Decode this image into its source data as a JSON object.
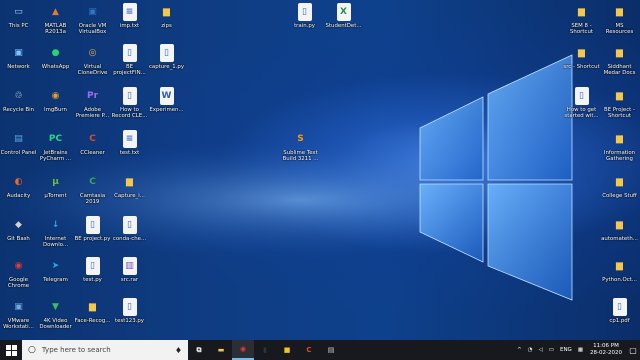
{
  "desktop": {
    "icons": [
      {
        "label": "This PC",
        "icon": "this-pc-icon",
        "color": "#9fd1ff"
      },
      {
        "label": "MATLAB R2013a",
        "icon": "matlab-icon",
        "color": "#e8792b"
      },
      {
        "label": "Oracle VM VirtualBox",
        "icon": "virtualbox-icon",
        "color": "#2f76c4"
      },
      {
        "label": "imp.txt",
        "icon": "text-file-icon",
        "color": "#ffffff"
      },
      {
        "label": "zips",
        "icon": "folder-icon",
        "color": "#f5c74b"
      },
      {
        "label": "train.py",
        "icon": "python-file-icon",
        "color": "#ffffff"
      },
      {
        "label": "StudentDet...",
        "icon": "excel-file-icon",
        "color": "#2a8a4a"
      },
      {
        "label": "SEM 8 - Shortcut",
        "icon": "folder-shortcut-icon",
        "color": "#f5c74b"
      },
      {
        "label": "MS Resources",
        "icon": "folder-icon",
        "color": "#f5c74b"
      },
      {
        "label": "Network",
        "icon": "network-icon",
        "color": "#7fc4ff"
      },
      {
        "label": "WhatsApp",
        "icon": "whatsapp-icon",
        "color": "#2cd46b"
      },
      {
        "label": "Virtual CloneDrive",
        "icon": "clonedrive-icon",
        "color": "#e0b050"
      },
      {
        "label": "BE projectFIN...",
        "icon": "file-icon",
        "color": "#ffffff"
      },
      {
        "label": "capture_1.py",
        "icon": "python-file-icon",
        "color": "#ffffff"
      },
      {
        "label": "src - Shortcut",
        "icon": "folder-shortcut-icon",
        "color": "#f5c74b"
      },
      {
        "label": "Siddhant Medar Docs",
        "icon": "folder-icon",
        "color": "#f5c74b"
      },
      {
        "label": "Recycle Bin",
        "icon": "recycle-bin-icon",
        "color": "#cfe3ff"
      },
      {
        "label": "ImgBurn",
        "icon": "imgburn-icon",
        "color": "#f0a020"
      },
      {
        "label": "Adobe Premiere P...",
        "icon": "premiere-icon",
        "color": "#9b6df2"
      },
      {
        "label": "How to Record CLE...",
        "icon": "file-icon",
        "color": "#ffffff"
      },
      {
        "label": "Experimen...",
        "icon": "word-file-icon",
        "color": "#2b5fb8"
      },
      {
        "label": "How to get started wit...",
        "icon": "file-icon",
        "color": "#ffffff"
      },
      {
        "label": "BE Project - Shortcut",
        "icon": "folder-shortcut-icon",
        "color": "#f5c74b"
      },
      {
        "label": "Control Panel",
        "icon": "control-panel-icon",
        "color": "#5aa8e6"
      },
      {
        "label": "JetBrains PyCharm ...",
        "icon": "pycharm-icon",
        "color": "#21d789"
      },
      {
        "label": "CCleaner",
        "icon": "ccleaner-icon",
        "color": "#e04b2a"
      },
      {
        "label": "test.txt",
        "icon": "text-file-icon",
        "color": "#ffffff"
      },
      {
        "label": "Sublime Text Build 3211 ...",
        "icon": "sublime-text-icon",
        "color": "#ff9800"
      },
      {
        "label": "Information Gathering",
        "icon": "folder-icon",
        "color": "#f5c74b"
      },
      {
        "label": "Audacity",
        "icon": "audacity-icon",
        "color": "#f06a1a"
      },
      {
        "label": "µTorrent",
        "icon": "utorrent-icon",
        "color": "#6cbf3a"
      },
      {
        "label": "Camtasia 2019",
        "icon": "camtasia-icon",
        "color": "#3fa34d"
      },
      {
        "label": "Capture_i...",
        "icon": "folder-icon",
        "color": "#f5c74b"
      },
      {
        "label": "College Stuff",
        "icon": "folder-icon",
        "color": "#f5c74b"
      },
      {
        "label": "Git Bash",
        "icon": "git-bash-icon",
        "color": "#d0d0d0"
      },
      {
        "label": "Internet Downlo...",
        "icon": "idm-icon",
        "color": "#3c9be0"
      },
      {
        "label": "BE project.py",
        "icon": "python-file-icon",
        "color": "#ffffff"
      },
      {
        "label": "conda-che...",
        "icon": "file-icon",
        "color": "#ffffff"
      },
      {
        "label": "automateth...",
        "icon": "folder-icon",
        "color": "#f5c74b"
      },
      {
        "label": "Google Chrome",
        "icon": "chrome-icon",
        "color": "#e53935"
      },
      {
        "label": "Telegram",
        "icon": "telegram-icon",
        "color": "#2aa3e0"
      },
      {
        "label": "test.py",
        "icon": "python-file-icon",
        "color": "#ffffff"
      },
      {
        "label": "src.rar",
        "icon": "rar-file-icon",
        "color": "#7d4fbf"
      },
      {
        "label": "Python.Oct...",
        "icon": "folder-icon",
        "color": "#f5c74b"
      },
      {
        "label": "VMware Workstati...",
        "icon": "vmware-icon",
        "color": "#6fa8dc"
      },
      {
        "label": "4K Video Downloader",
        "icon": "4k-downloader-icon",
        "color": "#3fbf5a"
      },
      {
        "label": "Face-Recog...",
        "icon": "folder-icon",
        "color": "#f5c74b"
      },
      {
        "label": "test123.py",
        "icon": "python-file-icon",
        "color": "#ffffff"
      },
      {
        "label": "cp1.pdf",
        "icon": "pdf-file-icon",
        "color": "#ffffff"
      }
    ]
  },
  "taskbar": {
    "search_placeholder": "Type here to search",
    "apps": [
      {
        "icon": "task-view-icon",
        "glyph": "⧉",
        "color": "#ffffff",
        "active": false
      },
      {
        "icon": "file-explorer-icon",
        "glyph": "▬",
        "color": "#f5c74b",
        "active": false
      },
      {
        "icon": "chrome-icon",
        "glyph": "◉",
        "color": "#e53935",
        "active": true
      },
      {
        "icon": "terminal-icon",
        "glyph": "▮",
        "color": "#333333",
        "active": false
      },
      {
        "icon": "sticky-app-icon",
        "glyph": "■",
        "color": "#f5c518",
        "active": false
      },
      {
        "icon": "ccleaner-icon",
        "glyph": "C",
        "color": "#e04b2a",
        "active": false
      },
      {
        "icon": "capture-app-icon",
        "glyph": "▤",
        "color": "#cfcfcf",
        "active": false
      }
    ],
    "tray_lang": "ENG",
    "time": "11:06 PM",
    "date": "28-02-2020"
  }
}
